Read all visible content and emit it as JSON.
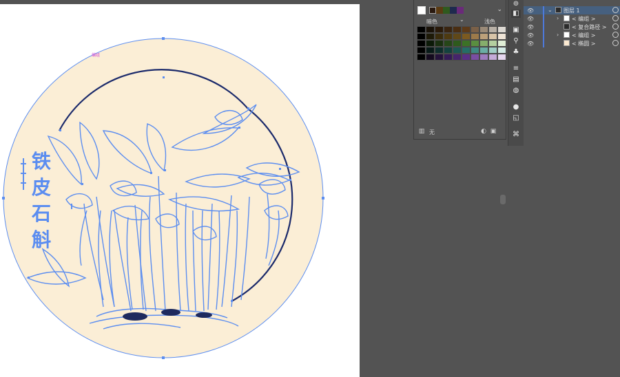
{
  "artwork": {
    "vertical_text": "铁皮石斛",
    "small_label": "编组"
  },
  "swatches": {
    "header_chips": [
      "#ffffff",
      "#2a1a10",
      "#5a3a12",
      "#2f5a1e",
      "#1e2a4e",
      "#6a2a7a"
    ],
    "dark_label": "暗色",
    "light_label": "浅色",
    "dropdown_glyph": "⌄",
    "arrow_glyph": "⌄",
    "footer_none": "无",
    "footer_icons": [
      "swatch-libraries-icon",
      "new-swatch-icon",
      "delete-swatch-icon"
    ],
    "rows": [
      [
        "#000000",
        "#1a1208",
        "#2a1a0a",
        "#3a2510",
        "#4a2e12",
        "#5d3a18",
        "#7a6048",
        "#9a8a78",
        "#b8b0a6",
        "#dcd8d2"
      ],
      [
        "#000000",
        "#1e1a08",
        "#3a2c0c",
        "#4e3a10",
        "#604818",
        "#7c5a20",
        "#9c7a4a",
        "#bca07a",
        "#d8c4a8",
        "#efe4d6"
      ],
      [
        "#000000",
        "#0c1a08",
        "#1a3010",
        "#264618",
        "#2e5a1c",
        "#3c7226",
        "#5a8e40",
        "#86ae6c",
        "#b4cfa0",
        "#dfeed6"
      ],
      [
        "#000000",
        "#081a18",
        "#0e2e2c",
        "#14423e",
        "#1c5852",
        "#246e66",
        "#3e8a82",
        "#6aaea4",
        "#a0cec6",
        "#d4ebe6"
      ],
      [
        "#000000",
        "#140a1e",
        "#24123a",
        "#341a56",
        "#46246c",
        "#5a2e86",
        "#7a4ea2",
        "#9e7cbe",
        "#c4aad8",
        "#e6d8f0"
      ]
    ]
  },
  "layers": {
    "rows": [
      {
        "name": "图层 1",
        "selected": true,
        "thumb": "#2b2b2b"
      },
      {
        "name": "< 编组 >",
        "selected": false,
        "thumb": "#ffffff"
      },
      {
        "name": "< 复合路径 >",
        "selected": false,
        "thumb": "#2b2b2b"
      },
      {
        "name": "< 编组 >",
        "selected": false,
        "thumb": "#ffffff"
      },
      {
        "name": "< 椭圆 >",
        "selected": false,
        "thumb": "#fbe9d0"
      }
    ]
  },
  "toolstrip": {
    "icons": [
      "properties-icon",
      "gradient-icon",
      "image-trace-icon",
      "puppet-icon",
      "club-symbol-icon",
      "align-icon",
      "transparency-icon",
      "pathfinder-icon",
      "color-guide-icon",
      "export-icon",
      "libraries-icon"
    ]
  },
  "colors": {
    "bg_dark": "#535353",
    "path_blue": "#5b8df0",
    "disc_fill": "#fbeed6",
    "arc_navy": "#1b2a6b",
    "selection_magenta": "#d44bd4"
  }
}
